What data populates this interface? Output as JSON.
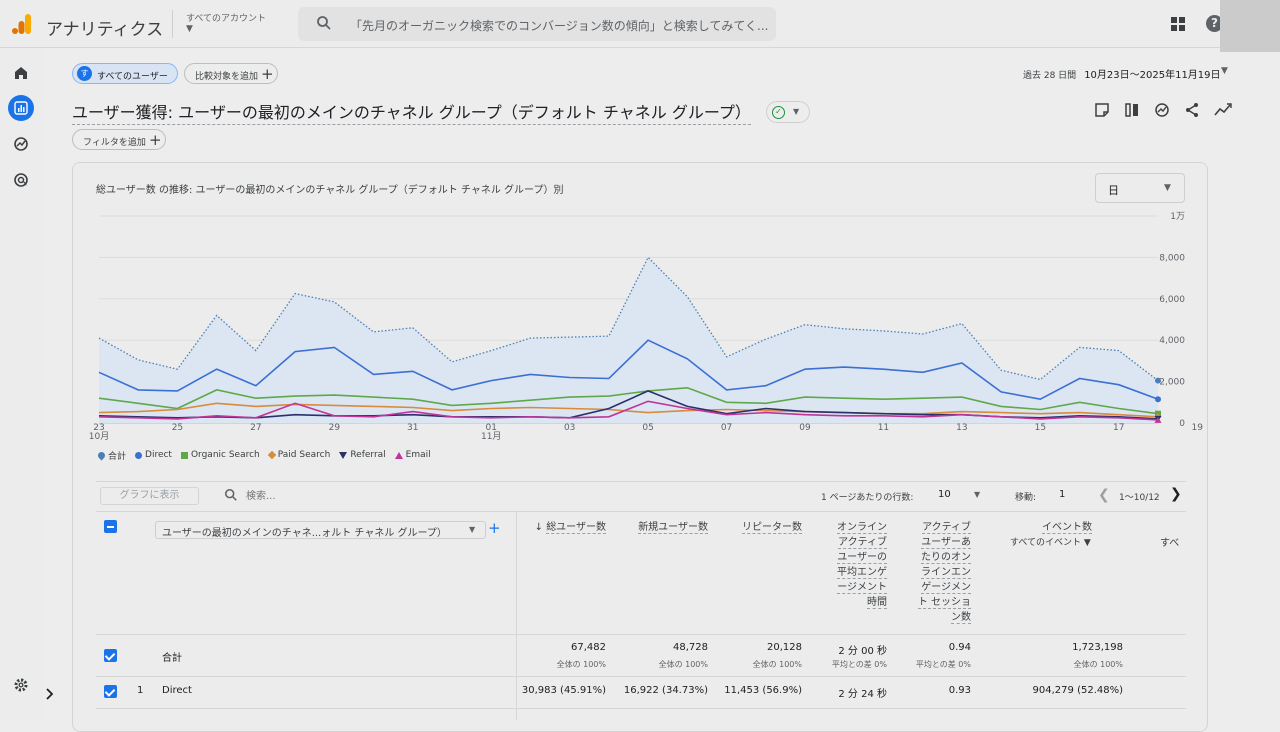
{
  "app": {
    "title": "アナリティクス",
    "account_label": "すべてのアカウント",
    "search_placeholder": "「先月のオーガニック検索でのコンバージョン数の傾向」と検索してみてく...",
    "icons": {
      "logo": "analytics-logo",
      "search": "search-icon",
      "apps": "apps-grid-icon",
      "help": "help-icon"
    }
  },
  "nav": {
    "items": [
      "home-icon",
      "reports-icon",
      "explore-icon",
      "advertising-icon"
    ],
    "active": "reports-icon",
    "settings": "gear-icon",
    "expand": "chevron-right-icon"
  },
  "segment": {
    "avatar": "す",
    "label": "すべてのユーザー"
  },
  "compare_label": "比較対象を追加",
  "date": {
    "period": "過去 28 日間",
    "range": "10月23日〜2025年11月19日"
  },
  "page_title": "ユーザー獲得: ユーザーの最初のメインのチャネル グループ（デフォルト チャネル グループ）",
  "filter_label": "フィルタを追加",
  "chart_title": "総ユーザー数 の推移: ユーザーの最初のメインのチャネル グループ（デフォルト チャネル グループ）別",
  "period_select": "日",
  "chart_data": {
    "type": "line",
    "x": [
      "10/23",
      "10/24",
      "10/25",
      "10/26",
      "10/27",
      "10/28",
      "10/29",
      "10/30",
      "10/31",
      "11/01",
      "11/02",
      "11/03",
      "11/04",
      "11/05",
      "11/06",
      "11/07",
      "11/08",
      "11/09",
      "11/10",
      "11/11",
      "11/12",
      "11/13",
      "11/14",
      "11/15",
      "11/16",
      "11/17",
      "11/18",
      "11/19"
    ],
    "x_tick_labels": [
      {
        "main": "23",
        "sub": "10月"
      },
      {
        "main": "25",
        "sub": ""
      },
      {
        "main": "27",
        "sub": ""
      },
      {
        "main": "29",
        "sub": ""
      },
      {
        "main": "31",
        "sub": ""
      },
      {
        "main": "01",
        "sub": "11月"
      },
      {
        "main": "03",
        "sub": ""
      },
      {
        "main": "05",
        "sub": ""
      },
      {
        "main": "07",
        "sub": ""
      },
      {
        "main": "09",
        "sub": ""
      },
      {
        "main": "11",
        "sub": ""
      },
      {
        "main": "13",
        "sub": ""
      },
      {
        "main": "15",
        "sub": ""
      },
      {
        "main": "17",
        "sub": ""
      },
      {
        "main": "19",
        "sub": ""
      }
    ],
    "y_tick_labels": [
      "0",
      "2,000",
      "4,000",
      "6,000",
      "8,000",
      "1万"
    ],
    "ylim": [
      0,
      10000
    ],
    "grid": true,
    "legend_position": "bottom-left",
    "series": [
      {
        "name": "合計",
        "color": "#4a7fb5",
        "marker": "pin",
        "style": "dotted-area",
        "values": [
          4100,
          3050,
          2600,
          5200,
          3500,
          6250,
          5850,
          4400,
          4600,
          2950,
          3500,
          4100,
          4150,
          4200,
          8000,
          6100,
          3200,
          4050,
          4750,
          4550,
          4450,
          4300,
          4800,
          2550,
          2100,
          3650,
          3500,
          2050
        ]
      },
      {
        "name": "Direct",
        "color": "#3b6fd4",
        "marker": "dot",
        "style": "line",
        "values": [
          2450,
          1600,
          1550,
          2600,
          1800,
          3450,
          3650,
          2350,
          2500,
          1600,
          2050,
          2350,
          2200,
          2150,
          4000,
          3100,
          1600,
          1800,
          2600,
          2700,
          2600,
          2450,
          2900,
          1500,
          1150,
          2150,
          1850,
          1150
        ]
      },
      {
        "name": "Organic Search",
        "color": "#5fa84a",
        "marker": "square",
        "style": "line",
        "values": [
          1200,
          950,
          700,
          1600,
          1200,
          1300,
          1350,
          1250,
          1150,
          850,
          950,
          1100,
          1250,
          1300,
          1550,
          1700,
          1000,
          950,
          1250,
          1200,
          1150,
          1200,
          1250,
          800,
          650,
          1000,
          700,
          450
        ]
      },
      {
        "name": "Paid Search",
        "color": "#d98a3a",
        "marker": "diamond",
        "style": "line",
        "values": [
          500,
          550,
          650,
          950,
          800,
          900,
          850,
          800,
          750,
          600,
          700,
          750,
          700,
          650,
          500,
          600,
          650,
          600,
          550,
          500,
          450,
          450,
          550,
          500,
          450,
          500,
          400,
          300
        ]
      },
      {
        "name": "Referral",
        "color": "#2b2f6b",
        "marker": "triangle-down",
        "style": "line",
        "values": [
          350,
          300,
          250,
          300,
          250,
          400,
          350,
          350,
          400,
          300,
          300,
          300,
          250,
          700,
          1550,
          800,
          450,
          700,
          550,
          500,
          450,
          400,
          400,
          300,
          250,
          350,
          300,
          200
        ]
      },
      {
        "name": "Email",
        "color": "#c0349a",
        "marker": "triangle-up",
        "style": "line",
        "values": [
          300,
          250,
          200,
          350,
          250,
          950,
          350,
          300,
          550,
          300,
          250,
          300,
          250,
          300,
          1050,
          700,
          400,
          500,
          400,
          350,
          350,
          300,
          400,
          300,
          200,
          300,
          250,
          150
        ]
      }
    ]
  },
  "table": {
    "graph_button": "グラフに表示",
    "search_placeholder": "検索...",
    "rows_per_page_label": "1 ページあたりの行数:",
    "rows_per_page": "10",
    "goto_label": "移動:",
    "goto_value": "1",
    "range": "1〜10/12",
    "dimension": "ユーザーの最初のメインのチャネ...ォルト チャネル グループ）",
    "sort_arrow": "↓",
    "columns": [
      "総ユーザー数",
      "新規ユーザー数",
      "リピーター数",
      "オンラインアクティブユーザーの平均エンゲージメント時間",
      "アクティブユーザーあたりのオンラインエンゲージメント セッション数",
      "イベント数"
    ],
    "events_sub": "すべてのイベント",
    "overflow_col": "すべ",
    "total": {
      "label": "合計",
      "values": [
        "67,482",
        "48,728",
        "20,128",
        "2 分 00 秒",
        "0.94",
        "1,723,198"
      ],
      "subs": [
        "全体の 100%",
        "全体の 100%",
        "全体の 100%",
        "平均との差 0%",
        "平均との差 0%",
        "全体の 100%"
      ]
    },
    "rows": [
      {
        "index": "1",
        "label": "Direct",
        "values": [
          "30,983 (45.91%)",
          "16,922 (34.73%)",
          "11,453 (56.9%)",
          "2 分 24 秒",
          "0.93",
          "904,279 (52.48%)"
        ]
      }
    ]
  }
}
